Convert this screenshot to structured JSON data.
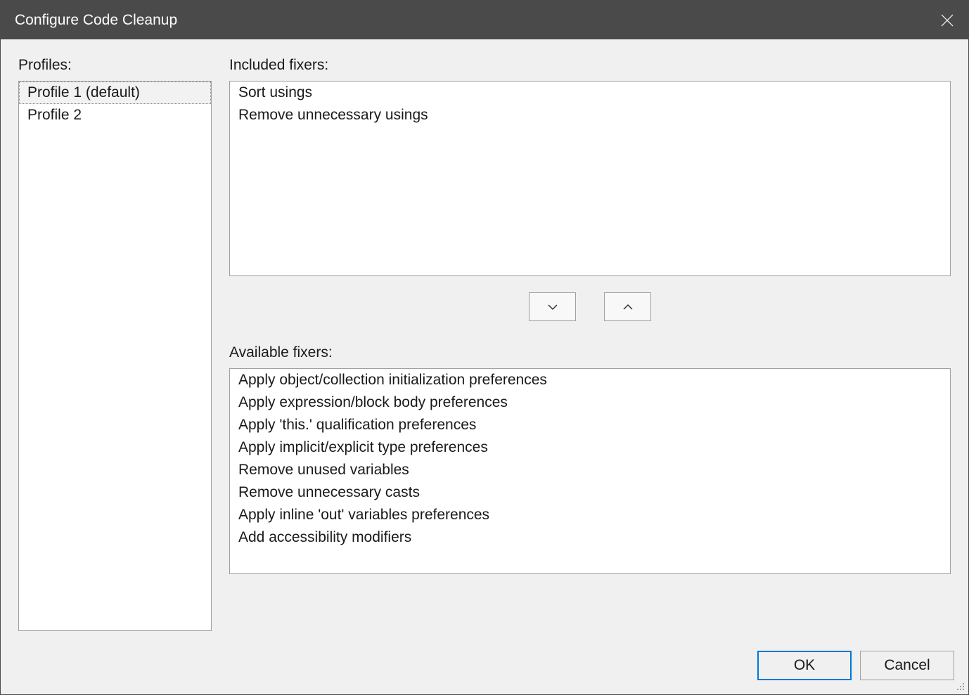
{
  "titlebar": {
    "title": "Configure Code Cleanup"
  },
  "labels": {
    "profiles": "Profiles:",
    "included": "Included fixers:",
    "available": "Available fixers:"
  },
  "profiles": {
    "items": [
      {
        "label": "Profile 1 (default)",
        "selected": true
      },
      {
        "label": "Profile 2",
        "selected": false
      }
    ]
  },
  "included_fixers": {
    "items": [
      "Sort usings",
      "Remove unnecessary usings"
    ]
  },
  "available_fixers": {
    "items": [
      "Apply object/collection initialization preferences",
      "Apply expression/block body preferences",
      "Apply 'this.' qualification preferences",
      "Apply implicit/explicit type preferences",
      "Remove unused variables",
      "Remove unnecessary casts",
      "Apply inline 'out' variables preferences",
      "Add accessibility modifiers"
    ]
  },
  "buttons": {
    "ok": "OK",
    "cancel": "Cancel"
  }
}
